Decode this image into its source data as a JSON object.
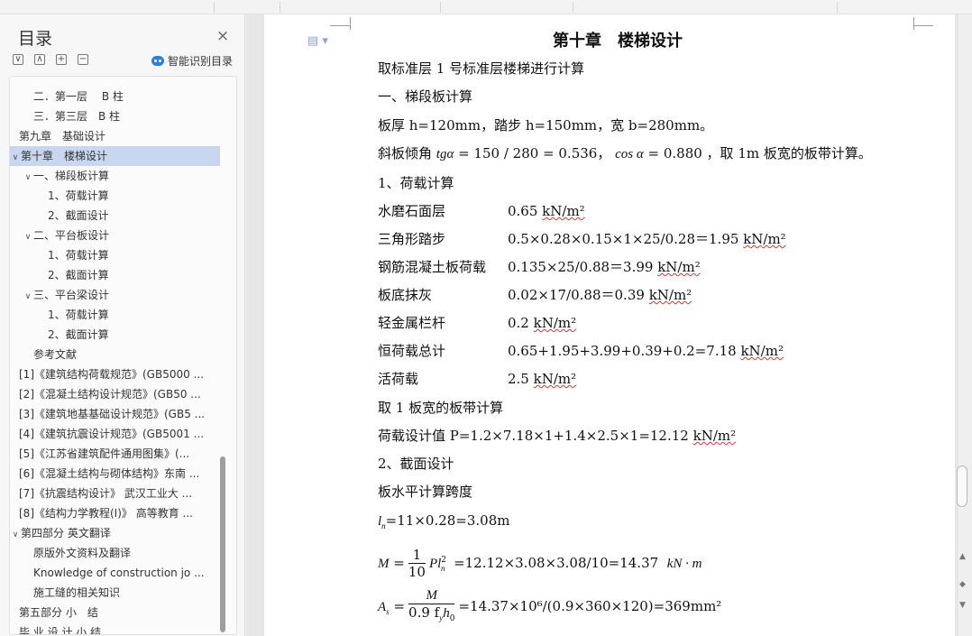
{
  "sidebar": {
    "title": "目录",
    "close": "×",
    "tools": [
      "∨",
      "∧",
      "+",
      "−"
    ],
    "ai_label": "智能识别目录",
    "items": [
      {
        "label": "二．第一层　 B 柱",
        "level": 2,
        "toggle": ""
      },
      {
        "label": "三．第三层　B 柱",
        "level": 2,
        "toggle": ""
      },
      {
        "label": "第九章　基础设计",
        "level": 1,
        "toggle": ""
      },
      {
        "label": "第十章　楼梯设计",
        "level": 1,
        "toggle": "∨",
        "active": true
      },
      {
        "label": "一、梯段板计算",
        "level": 2,
        "toggle": "∨"
      },
      {
        "label": "1、荷载计算",
        "level": 3,
        "toggle": ""
      },
      {
        "label": "2、截面设计",
        "level": 3,
        "toggle": ""
      },
      {
        "label": "二、平台板设计",
        "level": 2,
        "toggle": "∨"
      },
      {
        "label": "1、荷载计算",
        "level": 3,
        "toggle": ""
      },
      {
        "label": "2、截面计算",
        "level": 3,
        "toggle": ""
      },
      {
        "label": "三、平台梁设计",
        "level": 2,
        "toggle": "∨"
      },
      {
        "label": "1、荷载计算",
        "level": 3,
        "toggle": ""
      },
      {
        "label": "2、截面计算",
        "level": 3,
        "toggle": ""
      },
      {
        "label": "参考文献",
        "level": 2,
        "toggle": ""
      },
      {
        "label": "[1]《建筑结构荷载规范》(GB5000 ...",
        "level": 1,
        "toggle": ""
      },
      {
        "label": "[2]《混凝土结构设计规范》(GB50 ...",
        "level": 1,
        "toggle": ""
      },
      {
        "label": "[3]《建筑地基基础设计规范》(GB5 ...",
        "level": 1,
        "toggle": ""
      },
      {
        "label": "[4]《建筑抗震设计规范》(GB5001 ...",
        "level": 1,
        "toggle": ""
      },
      {
        "label": "[5]《江苏省建筑配件通用图集》(...",
        "level": 1,
        "toggle": ""
      },
      {
        "label": "[6]《混凝土结构与砌体结构》东南 ...",
        "level": 1,
        "toggle": ""
      },
      {
        "label": "[7]《抗震结构设计》 武汉工业大 ...",
        "level": 1,
        "toggle": ""
      },
      {
        "label": "[8]《结构力学教程(I)》 高等教育 ...",
        "level": 1,
        "toggle": ""
      },
      {
        "label": "第四部分  英文翻译",
        "level": 1,
        "toggle": "∨"
      },
      {
        "label": "原版外文资料及翻译",
        "level": 2,
        "toggle": ""
      },
      {
        "label": "Knowledge of construction jo ...",
        "level": 2,
        "toggle": ""
      },
      {
        "label": "施工缝的相关知识",
        "level": 2,
        "toggle": ""
      },
      {
        "label": "第五部分  小　结",
        "level": 1,
        "toggle": ""
      },
      {
        "label": "毕 业 设 计 小 结",
        "level": 1,
        "toggle": ""
      }
    ]
  },
  "document": {
    "title": "第十章　楼梯设计",
    "intro": "取标准层 1 号标准层楼梯进行计算",
    "sec1": "一、梯段板计算",
    "dims": "板厚 h=120mm，踏步 h=150mm，宽 b=280mm。",
    "incline_a": "斜板倾角 ",
    "incline_tg": "tgα",
    "incline_b": " = 150 / 280 = 0.536，  ",
    "incline_cos": "cos α",
    "incline_c": " = 0.880 ，取 1m 板宽的板带计算。",
    "sub1": "1、荷载计算",
    "unit": "kN/m²",
    "loads": [
      {
        "name": "水磨石面层",
        "value": "0.65 "
      },
      {
        "name": "三角形踏步",
        "value": "0.5×0.28×0.15×1×25/0.28＝1.95 "
      },
      {
        "name": "钢筋混凝土板荷载",
        "value": "0.135×25/0.88＝3.99 "
      },
      {
        "name": "板底抹灰",
        "value": "0.02×17/0.88＝0.39 "
      },
      {
        "name": "轻金属栏杆",
        "value": "0.2 "
      },
      {
        "name": "恒荷载总计",
        "value": "0.65+1.95+3.99+0.39+0.2=7.18 "
      },
      {
        "name": "活荷载",
        "value": "2.5 "
      }
    ],
    "take1m": "取 1 板宽的板带计算",
    "design_load": "荷载设计值 P=1.2×7.18×1+1.4×2.5×1=12.12 ",
    "sub2": "2、截面设计",
    "span_title": "板水平计算跨度",
    "ln_sym": "l",
    "ln_sub": "n",
    "ln_val": "=11×0.28=3.08m",
    "m_sym": "M",
    "m_num": "1",
    "m_den": "10",
    "m_pl": "Pl",
    "m_val": "=12.12×3.08×3.08/10=14.37",
    "m_unit": "kN · m",
    "as_sym": "A",
    "as_sub": "s",
    "as_num": "M",
    "as_den": "0.9 f",
    "as_val": "=14.37×10⁶/(0.9×360×120)=369mm²"
  }
}
